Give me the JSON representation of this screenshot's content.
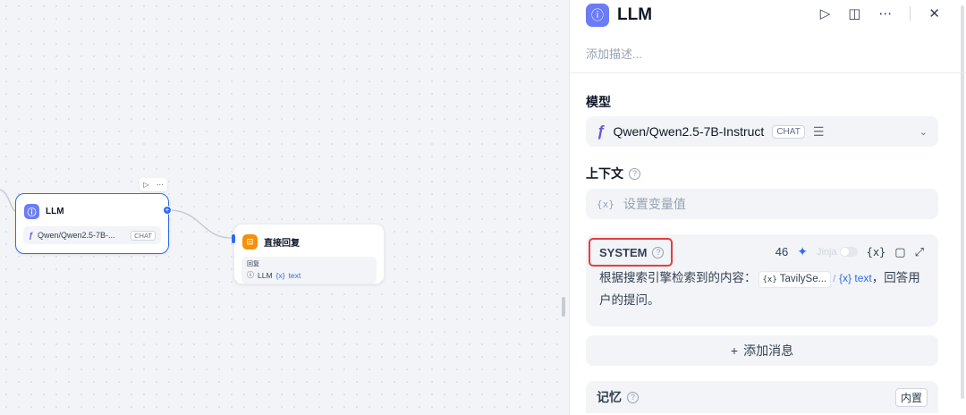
{
  "canvas": {
    "llm_node": {
      "title": "LLM",
      "model": "Qwen/Qwen2.5-7B-...",
      "model_tag": "CHAT",
      "run_icon": "play-icon",
      "more_icon": "more-icon"
    },
    "reply_node": {
      "title": "直接回复",
      "field_label": "回复",
      "var_node": "LLM",
      "var_name": "text"
    }
  },
  "panel": {
    "title": "LLM",
    "description_placeholder": "添加描述...",
    "model_section": {
      "label": "模型",
      "model_name": "Qwen/Qwen2.5-7B-Instruct",
      "model_tag": "CHAT"
    },
    "context_section": {
      "label": "上下文",
      "placeholder": "设置变量值"
    },
    "system_prompt": {
      "role": "SYSTEM",
      "token_count": "46",
      "jinja_label": "Jinja",
      "text_before": "根据搜索引擎检索到的内容：",
      "var_source": "TavilySe...",
      "var_sep": "/",
      "var_name": "text",
      "text_after": "，回答用户的提问。"
    },
    "add_message_label": "添加消息",
    "memory_section": {
      "label": "记忆",
      "badge": "内置"
    }
  },
  "colors": {
    "accent": "#2f6bf0",
    "llm_icon": "#6b7cf6",
    "reply_icon": "#f79009",
    "highlight": "#e53e3e"
  }
}
